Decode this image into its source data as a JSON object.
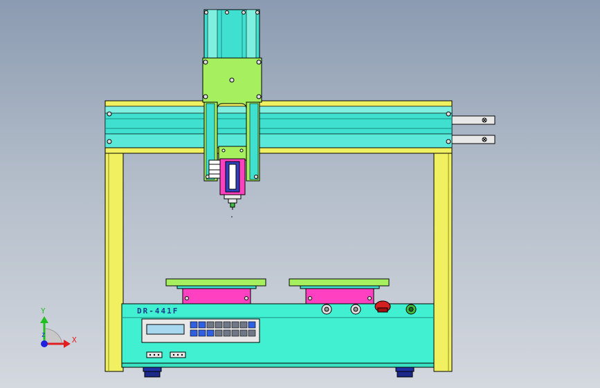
{
  "viewport": {
    "background_top": "#8b9bb1",
    "background_bottom": "#d4d8df"
  },
  "machine": {
    "model_label": "DR-441F",
    "colors": {
      "frame_yellow": "#f0f060",
      "beam_cyan": "#40e0d0",
      "head_green": "#a6f060",
      "fixture_magenta": "#ff40c0",
      "base_aqua": "#40f0d0",
      "estop_red": "#d42020",
      "foot_blue": "#2030a0"
    }
  },
  "controller": {
    "lcd_text": "",
    "keys": [
      "blue",
      "blue",
      "grey",
      "grey",
      "grey",
      "grey",
      "grey",
      "blue",
      "blue",
      "blue",
      "blue",
      "grey",
      "grey",
      "grey",
      "grey",
      "grey"
    ]
  },
  "panel_buttons": [
    "button-icon",
    "button-icon",
    "emergency-stop-icon",
    "power-icon"
  ],
  "triad": {
    "x_label": "X",
    "y_label": "Y",
    "z_label": "Z",
    "x_color": "#e02020",
    "y_color": "#20c020",
    "z_color": "#2020e0"
  }
}
